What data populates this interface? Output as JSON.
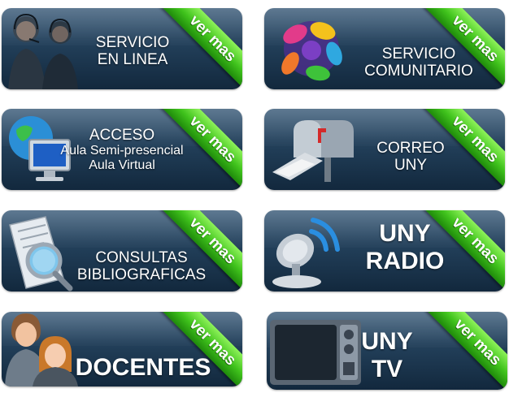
{
  "tiles": [
    {
      "id": "servicio_linea",
      "lines": [
        "SERVICIO",
        "EN LINEA"
      ],
      "ribbon": "ver mas",
      "icon": "call-center-operators-icon"
    },
    {
      "id": "servicio_comunitario",
      "lines": [
        "SERVICIO",
        "COMUNITARIO"
      ],
      "ribbon": "ver mas",
      "icon": "community-hands-icon"
    },
    {
      "id": "acceso",
      "lines": [
        "ACCESO",
        "Aula Semi-presencial",
        "Aula Virtual"
      ],
      "ribbon": "ver mas",
      "icon": "computer-globe-icon"
    },
    {
      "id": "correo",
      "lines": [
        "CORREO",
        "UNY"
      ],
      "ribbon": "ver mas",
      "icon": "mailbox-icon"
    },
    {
      "id": "consultas",
      "lines": [
        "CONSULTAS",
        "BIBLIOGRAFICAS"
      ],
      "ribbon": "ver mas",
      "icon": "document-magnifier-icon"
    },
    {
      "id": "radio",
      "lines": [
        "UNY",
        "RADIO"
      ],
      "ribbon": "ver mas",
      "icon": "satellite-dish-icon"
    },
    {
      "id": "docentes",
      "lines": [
        "DOCENTES"
      ],
      "ribbon": "ver mas",
      "icon": "teachers-icon"
    },
    {
      "id": "tv",
      "lines": [
        "UNY",
        "TV"
      ],
      "ribbon": "ver mas",
      "icon": "television-icon"
    }
  ],
  "colors": {
    "tile_top": "#3f5f7c",
    "tile_bottom": "#12283d",
    "ribbon_green": "#3fc21c",
    "label": "#ffffff"
  }
}
